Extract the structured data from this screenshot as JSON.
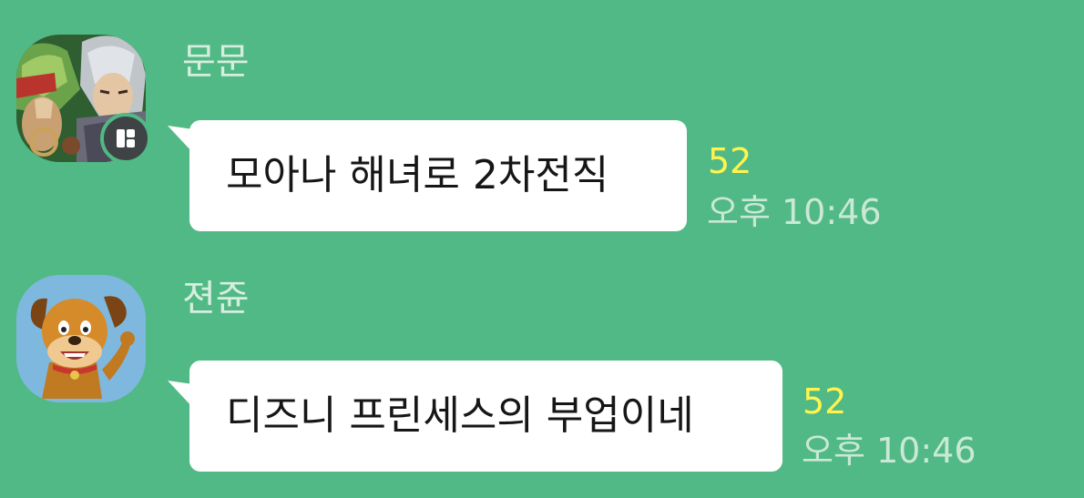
{
  "colors": {
    "background": "#51b985",
    "bubble": "#ffffff",
    "unread_count": "#fff44f",
    "sender_name": "#d6eedf",
    "time": "#c9e8d5"
  },
  "messages": [
    {
      "sender": "문문",
      "text": "모아나 해녀로 2차전직",
      "unread": "52",
      "time": "오후 10:46",
      "avatar_icon": "anime-character-avatar",
      "badge_icon": "status-badge-icon"
    },
    {
      "sender": "젼쥰",
      "text": "디즈니 프린세스의 부업이네",
      "unread": "52",
      "time": "오후 10:46",
      "avatar_icon": "dog-character-avatar"
    }
  ]
}
